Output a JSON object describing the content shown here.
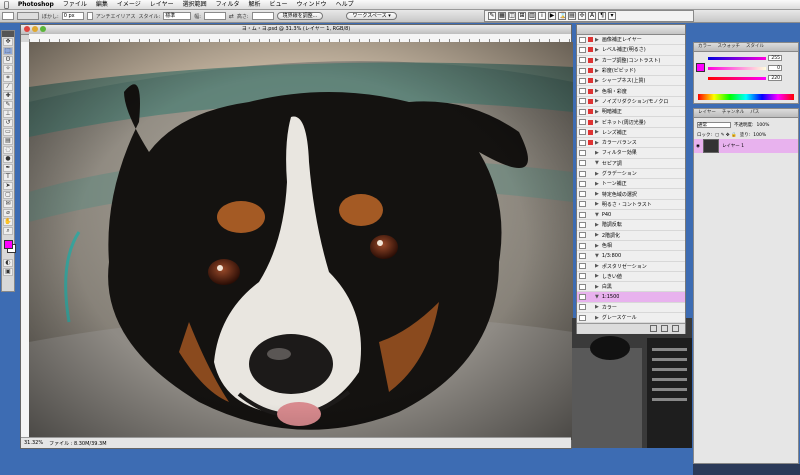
{
  "menubar": {
    "app_name": "Photoshop",
    "items": [
      "ファイル",
      "編集",
      "イメージ",
      "レイヤー",
      "選択範囲",
      "フィルタ",
      "解析",
      "ビュー",
      "ウィンドウ",
      "ヘルプ"
    ]
  },
  "options_bar": {
    "feather_label": "ぼかし:",
    "feather_value": "0 px",
    "antialias_label": "アンチエイリアス",
    "style_label": "スタイル:",
    "style_value": "標準",
    "width_label": "幅:",
    "height_label": "高さ:",
    "refine_button": "境界線を調整...",
    "workspace_label": "ワークスペース ▾"
  },
  "document": {
    "title": "ヨ・ム・ヨ.psd @ 31.3% (レイヤー 1, RGB/8)",
    "zoom": "31.32%",
    "status_text": "ファイル : 8.30M/39.3M"
  },
  "history": {
    "items": [
      {
        "label": "画像補正レイヤー",
        "arrow": "▶",
        "marker": "#d33"
      },
      {
        "label": "レベル補正(明るさ)",
        "arrow": "▶",
        "marker": "#d33"
      },
      {
        "label": "カーブ調整(コントラスト)",
        "arrow": "▶",
        "marker": "#d33"
      },
      {
        "label": "彩度(ビビッド)",
        "arrow": "▶",
        "marker": "#d33"
      },
      {
        "label": "シャープネス(上質)",
        "arrow": "▶",
        "marker": "#d33"
      },
      {
        "label": "色相・彩度",
        "arrow": "▶",
        "marker": "#d33"
      },
      {
        "label": "ノイズリダクション/モノクロ",
        "arrow": "▶",
        "marker": "#d33"
      },
      {
        "label": "明暗補正",
        "arrow": "▶",
        "marker": "#d33"
      },
      {
        "label": "ビネット(周辺光量)",
        "arrow": "▶",
        "marker": "#d33"
      },
      {
        "label": "レンズ補正",
        "arrow": "▶",
        "marker": "#d33"
      },
      {
        "label": "カラーバランス",
        "arrow": "▶",
        "marker": "#d33"
      },
      {
        "label": "フィルター効果",
        "arrow": "▶",
        "marker": ""
      },
      {
        "label": "セピア調",
        "arrow": "▼",
        "marker": ""
      },
      {
        "label": "グラデーション",
        "arrow": "▶",
        "marker": ""
      },
      {
        "label": "トーン補正",
        "arrow": "▶",
        "marker": ""
      },
      {
        "label": "特定色域の選択",
        "arrow": "▶",
        "marker": ""
      },
      {
        "label": "明るさ・コントラスト",
        "arrow": "▶",
        "marker": ""
      },
      {
        "label": "P40",
        "arrow": "▼",
        "marker": ""
      },
      {
        "label": "階調反転",
        "arrow": "▶",
        "marker": ""
      },
      {
        "label": "2階調化",
        "arrow": "▶",
        "marker": ""
      },
      {
        "label": "色相",
        "arrow": "▶",
        "marker": ""
      },
      {
        "label": "1/3:800",
        "arrow": "▼",
        "marker": ""
      },
      {
        "label": "ポスタリゼーション",
        "arrow": "▶",
        "marker": ""
      },
      {
        "label": "しきい値",
        "arrow": "▶",
        "marker": ""
      },
      {
        "label": "白黒",
        "arrow": "▶",
        "marker": ""
      },
      {
        "label": "1:1500",
        "arrow": "▼",
        "marker": "",
        "selected": true
      },
      {
        "label": "カラー",
        "arrow": "▶",
        "marker": ""
      },
      {
        "label": "グレースケール",
        "arrow": "▶",
        "marker": ""
      },
      {
        "label": "露光量",
        "arrow": "▶",
        "marker": ""
      }
    ]
  },
  "color_panel": {
    "tabs": [
      "カラー",
      "スウォッチ",
      "スタイル"
    ],
    "r_value": "255",
    "g_value": "0",
    "b_value": "220",
    "fg_color": "#ff00ff"
  },
  "layers_panel": {
    "tabs": [
      "レイヤー",
      "チャンネル",
      "パス"
    ],
    "blend_mode": "通常",
    "opacity_label": "不透明度:",
    "opacity": "100%",
    "lock_label": "ロック:",
    "fill_label": "塗り:",
    "fill": "100%",
    "layer_name": "レイヤー 1"
  },
  "colors": {
    "accent_selection": "#e8b2ee",
    "desktop": "#3d6cb3"
  }
}
